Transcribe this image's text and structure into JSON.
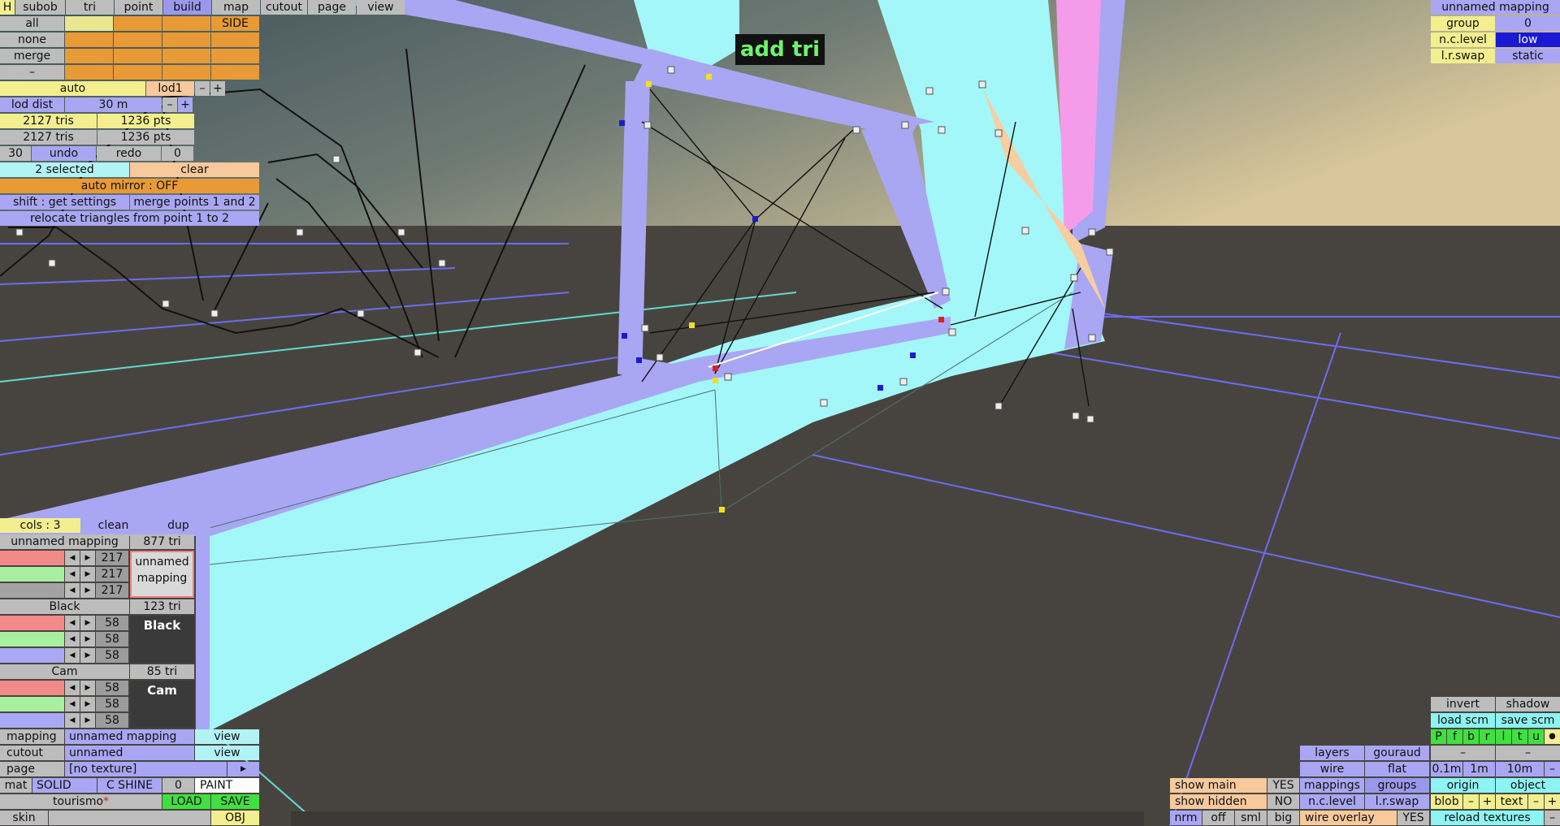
{
  "mode_banner": "add tri",
  "top_tabs": {
    "h": "H",
    "subob": "subob",
    "tri": "tri",
    "point": "point",
    "build": "build",
    "map": "map",
    "cutout": "cutout",
    "page": "page",
    "view": "view"
  },
  "select": {
    "all": "all",
    "none": "none",
    "merge": "merge",
    "dash": "–",
    "side": "SIDE"
  },
  "lod": {
    "auto": "auto",
    "level": "lod1",
    "minus": "–",
    "plus": "+",
    "dist_label": "lod dist",
    "dist_value": "30 m"
  },
  "stats": {
    "row1_tris": "2127 tris",
    "row1_pts": "1236 pts",
    "row2_tris": "2127 tris",
    "row2_pts": "1236 pts"
  },
  "history": {
    "count": "30",
    "undo": "undo",
    "redo": "redo",
    "redo_count": "0"
  },
  "selection": {
    "selected": "2 selected",
    "clear": "clear"
  },
  "auto_mirror": "auto mirror : OFF",
  "shift_settings": "shift : get settings",
  "merge_points": "merge points 1 and 2",
  "relocate": "relocate triangles from point 1 to 2",
  "cols": {
    "label": "cols : 3",
    "clean": "clean",
    "dup": "dup"
  },
  "groups": [
    {
      "name": "unnamed mapping",
      "tris": "877 tri",
      "r": "217",
      "g": "217",
      "b": "217",
      "preview": "unnamed mapping"
    },
    {
      "name": "Black",
      "tris": "123 tri",
      "r": "58",
      "g": "58",
      "b": "58",
      "preview": "Black"
    },
    {
      "name": "Cam",
      "tris": "85 tri",
      "r": "58",
      "g": "58",
      "b": "58",
      "preview": "Cam"
    }
  ],
  "bottom_left": {
    "mapping_label": "mapping",
    "mapping_value": "unnamed mapping",
    "mapping_view": "view",
    "cutout_label": "cutout",
    "cutout_value": "unnamed",
    "cutout_view": "view",
    "page_label": "page",
    "page_value": "[no texture]",
    "page_arrow": "▶",
    "mat": "mat",
    "solid": "SOLID",
    "cshine": "C SHINE",
    "shine_value": "0",
    "paint": "PAINT",
    "file_name": "tourismo",
    "file_dirty": "*",
    "load": "LOAD",
    "save": "SAVE",
    "skin": "skin",
    "obj": "OBJ"
  },
  "top_right": {
    "title": "unnamed mapping",
    "group_label": "group",
    "group_value": "0",
    "nc_label": "n.c.level",
    "nc_value": "low",
    "lr_label": "l.r.swap",
    "lr_value": "static"
  },
  "bottom_right": {
    "invert": "invert",
    "shadow": "shadow",
    "load_scm": "load scm",
    "save_scm": "save scm",
    "views": [
      "P",
      "f",
      "b",
      "r",
      "l",
      "t",
      "u",
      "●"
    ],
    "layers": "layers",
    "gouraud": "gouraud",
    "dash": "–",
    "wire": "wire",
    "flat": "flat",
    "grid_01": "0.1m",
    "grid_1": "1m",
    "grid_10": "10m",
    "show_main": "show main",
    "show_main_value": "YES",
    "mappings": "mappings",
    "groups": "groups",
    "origin": "origin",
    "object": "object",
    "show_hidden": "show hidden",
    "show_hidden_value": "NO",
    "nclevel": "n.c.level",
    "lrswap": "l.r.swap",
    "blob": "blob",
    "text": "text",
    "minus": "–",
    "plus": "+",
    "nrm": "nrm",
    "off": "off",
    "sml": "sml",
    "big": "big",
    "wire_overlay": "wire overlay",
    "wire_overlay_value": "YES",
    "reload_textures": "reload textures"
  }
}
